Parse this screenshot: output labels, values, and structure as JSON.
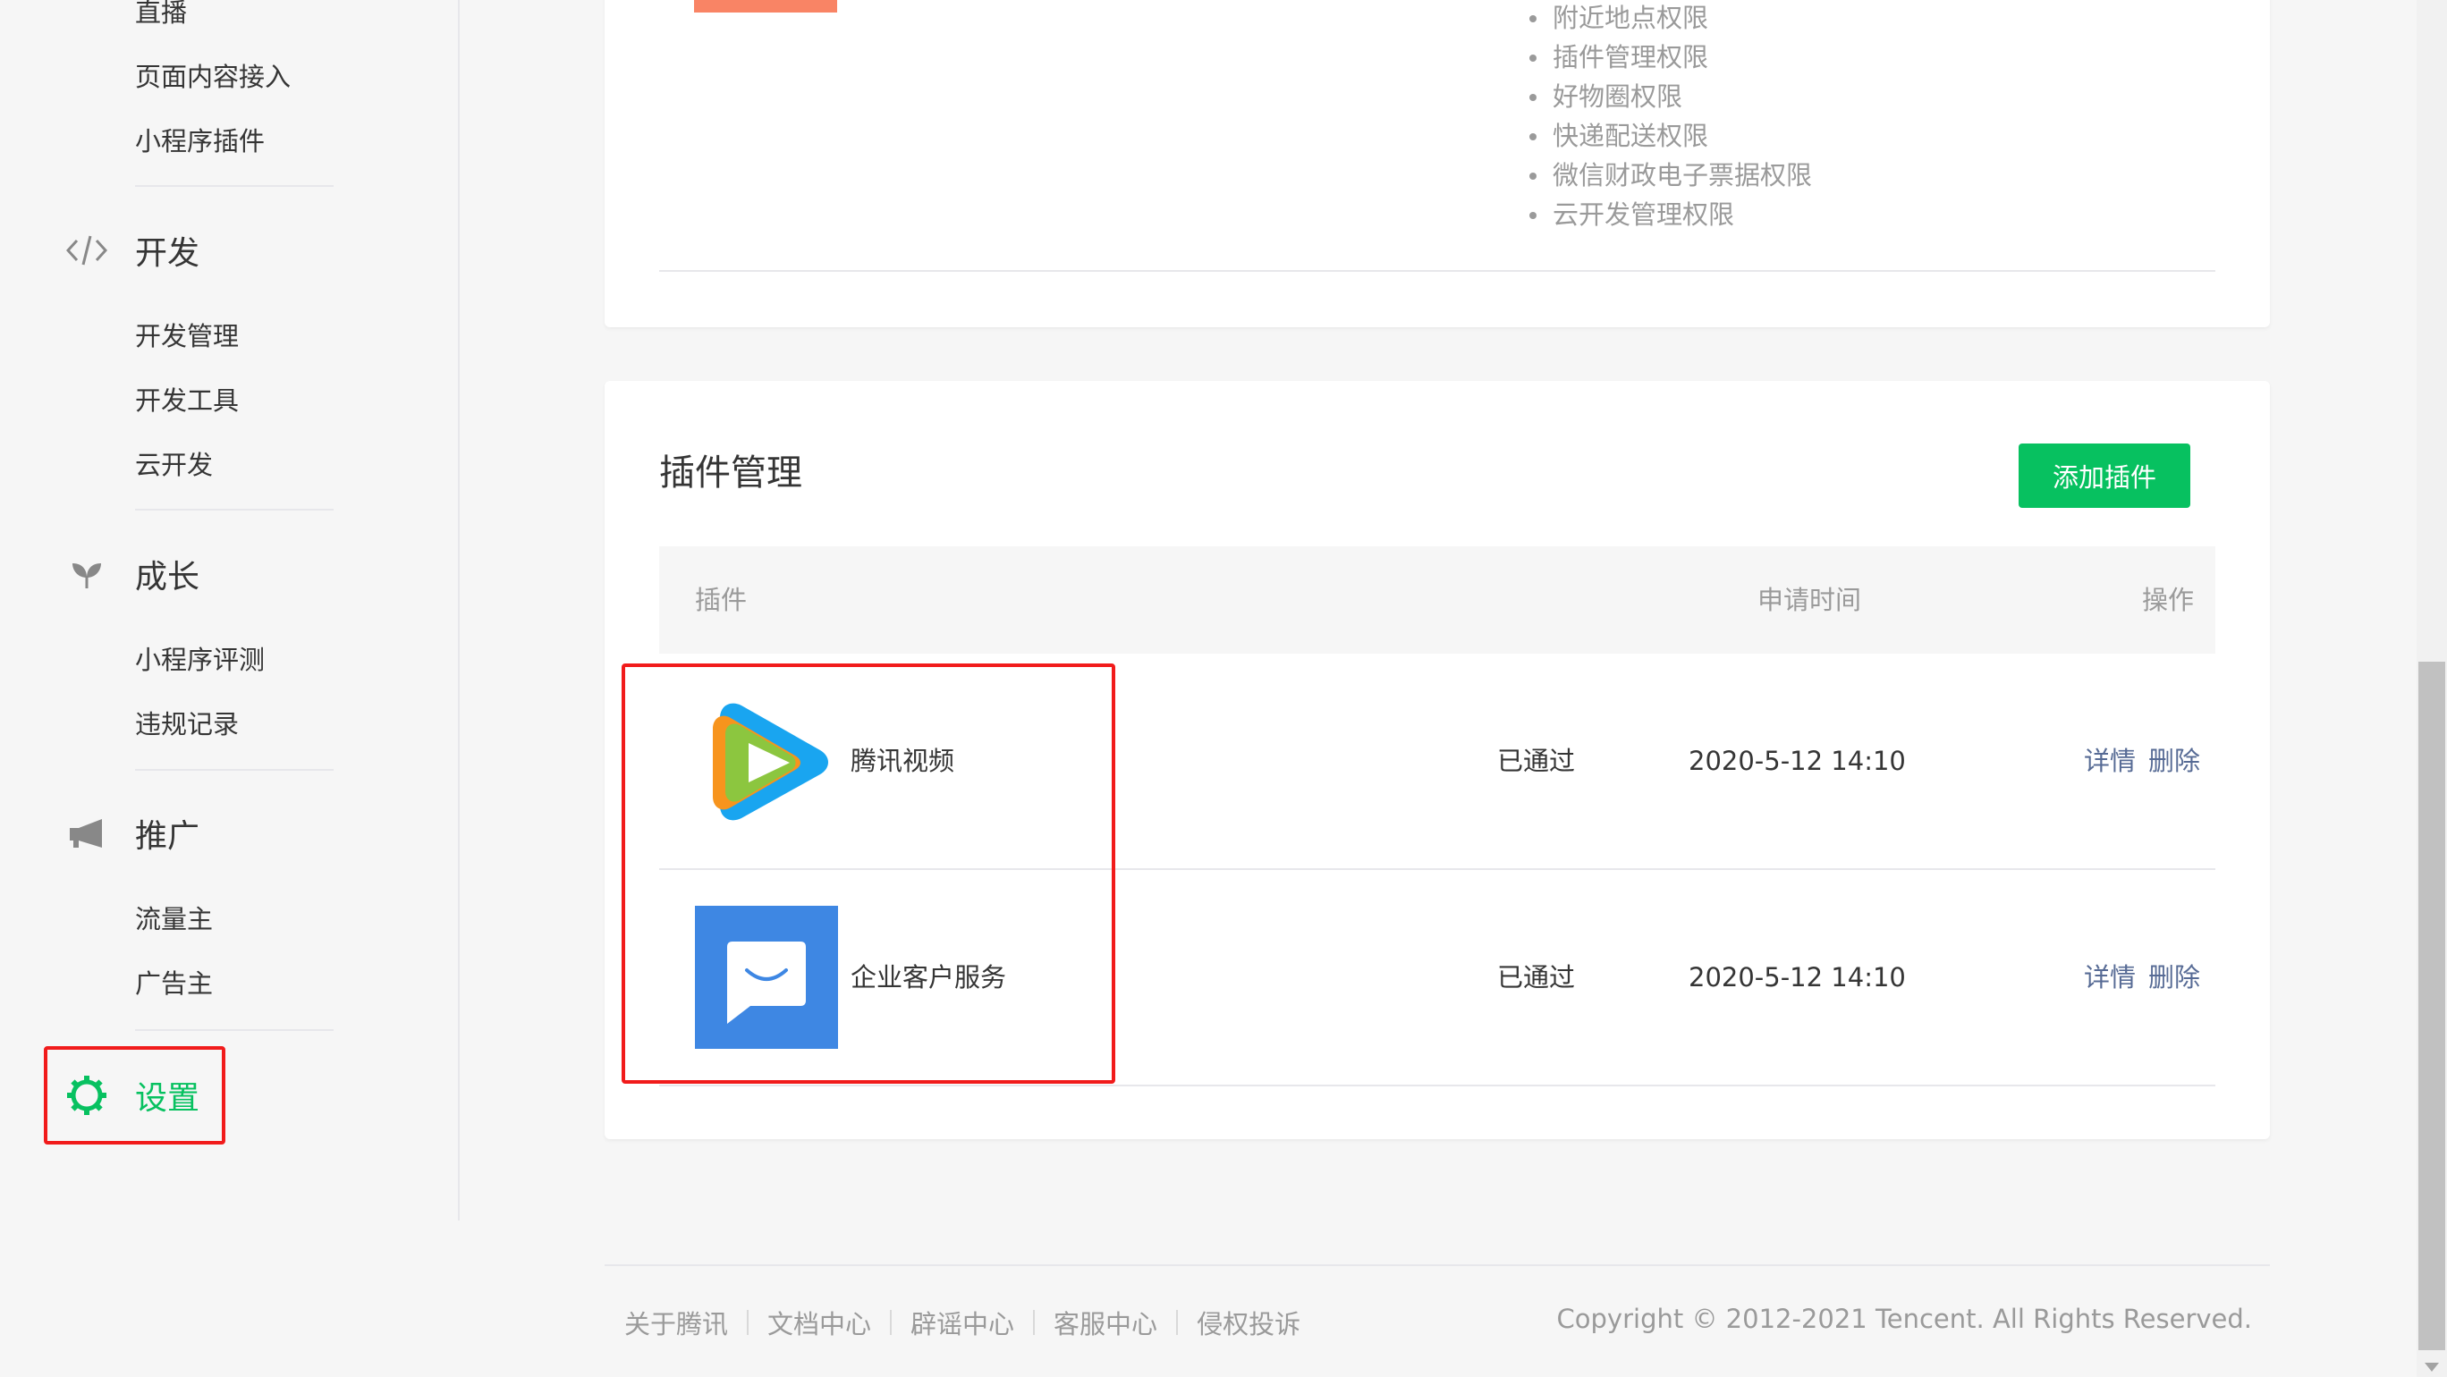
{
  "sidebar": {
    "top_items": [
      "直播",
      "页面内容接入",
      "小程序插件"
    ],
    "groups": [
      {
        "label": "开发",
        "icon": "code-icon",
        "items": [
          "开发管理",
          "开发工具",
          "云开发"
        ]
      },
      {
        "label": "成长",
        "icon": "sprout-icon",
        "items": [
          "小程序评测",
          "违规记录"
        ]
      },
      {
        "label": "推广",
        "icon": "megaphone-icon",
        "items": [
          "流量主",
          "广告主"
        ]
      }
    ],
    "settings": {
      "label": "设置",
      "icon": "gear-icon"
    }
  },
  "permissions_card": {
    "items": [
      "附近地点权限",
      "插件管理权限",
      "好物圈权限",
      "快递配送权限",
      "微信财政电子票据权限",
      "云开发管理权限"
    ]
  },
  "plugins_card": {
    "title": "插件管理",
    "add_button": "添加插件",
    "columns": [
      "插件",
      "申请时间",
      "操作"
    ],
    "rows": [
      {
        "name": "腾讯视频",
        "icon": "tencent-video-logo",
        "status": "已通过",
        "time": "2020-5-12 14:10",
        "detail": "详情",
        "delete": "删除"
      },
      {
        "name": "企业客户服务",
        "icon": "customer-service-chat-icon",
        "status": "已通过",
        "time": "2020-5-12 14:10",
        "detail": "详情",
        "delete": "删除"
      }
    ]
  },
  "footer": {
    "links": [
      "关于腾讯",
      "文档中心",
      "辟谣中心",
      "客服中心",
      "侵权投诉"
    ],
    "copyright": "Copyright © 2012-2021 Tencent. All Rights Reserved."
  },
  "colors": {
    "brand_green": "#07c160",
    "link_blue": "#576b95",
    "annotation_red": "#f11b1b",
    "orange": "#f98465",
    "chat_blue": "#3e87e3"
  }
}
